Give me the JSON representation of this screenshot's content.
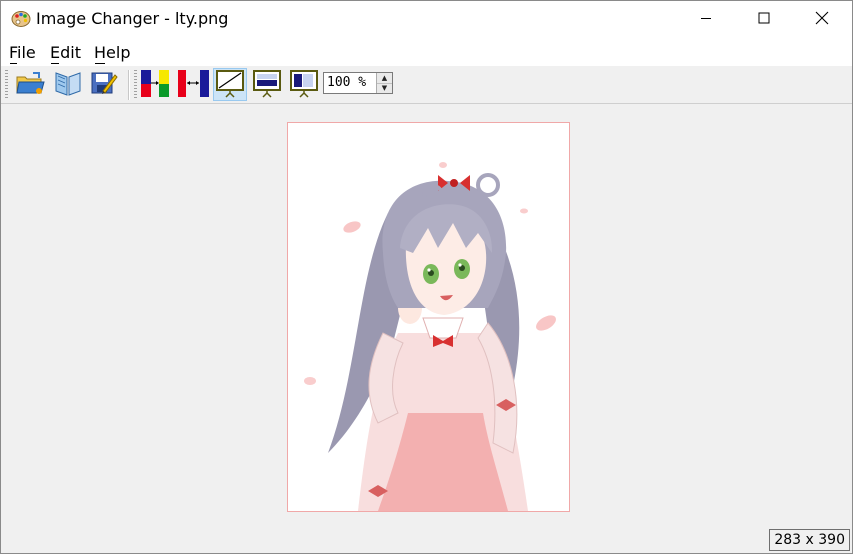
{
  "window": {
    "title": "Image Changer - lty.png",
    "minimize_icon": "minimize-icon",
    "maximize_icon": "maximize-icon",
    "close_icon": "close-icon"
  },
  "menu": {
    "items": [
      {
        "label": "File",
        "accel": "F"
      },
      {
        "label": "Edit",
        "accel": "E"
      },
      {
        "label": "Help",
        "accel": "H"
      }
    ]
  },
  "toolbar": {
    "buttons": [
      {
        "icon": "open-folder-icon"
      },
      {
        "icon": "open-book-icon"
      },
      {
        "icon": "save-edit-icon"
      },
      {
        "icon": "color-bars-resize-icon"
      },
      {
        "icon": "color-bars-shrink-icon"
      },
      {
        "icon": "fit-diagonal-icon"
      },
      {
        "icon": "fit-width-icon"
      },
      {
        "icon": "fit-height-icon"
      }
    ],
    "zoom_value": "100 %"
  },
  "status": {
    "dimensions": "283 x 390"
  },
  "colors": {
    "accent_active": "#cce4f7",
    "image_border": "#f0a8a8"
  }
}
